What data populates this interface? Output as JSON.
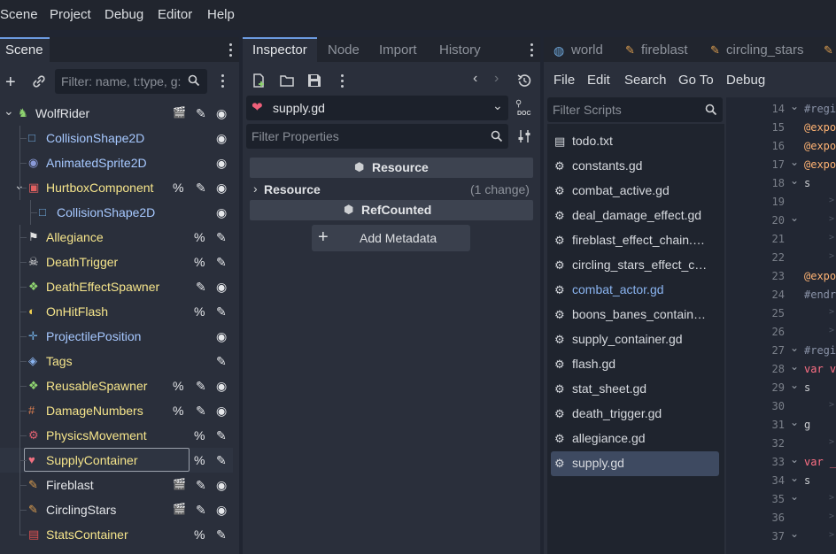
{
  "menubar": {
    "items": [
      "Scene",
      "Project",
      "Debug",
      "Editor",
      "Help"
    ]
  },
  "scene_dock": {
    "tab": "Scene",
    "filter_placeholder": "Filter: name, t:type, g:",
    "nodes": [
      {
        "label": "WolfRider",
        "icon": "kinematic-body-icon",
        "color": "#e4e6e9",
        "flags": [
          "clapper",
          "script",
          "eye"
        ]
      },
      {
        "label": "CollisionShape2D",
        "icon": "collision-shape-icon",
        "color": "#a6c8ff",
        "flags": [
          "eye"
        ]
      },
      {
        "label": "AnimatedSprite2D",
        "icon": "animated-sprite-icon",
        "color": "#a6c8ff",
        "flags": [
          "eye"
        ]
      },
      {
        "label": "HurtboxComponent",
        "icon": "hurtbox-icon",
        "color": "#f6e58b",
        "flags": [
          "%",
          "script",
          "eye"
        ]
      },
      {
        "label": "CollisionShape2D",
        "icon": "collision-shape-icon",
        "color": "#a6c8ff",
        "flags": [
          "eye"
        ]
      },
      {
        "label": "Allegiance",
        "icon": "allegiance-icon",
        "color": "#f6e58b",
        "flags": [
          "%",
          "script"
        ]
      },
      {
        "label": "DeathTrigger",
        "icon": "skull-icon",
        "color": "#f6e58b",
        "flags": [
          "%",
          "script"
        ]
      },
      {
        "label": "DeathEffectSpawner",
        "icon": "spawner-icon",
        "color": "#f6e58b",
        "flags": [
          "script",
          "eye"
        ]
      },
      {
        "label": "OnHitFlash",
        "icon": "bulb-icon",
        "color": "#f6e58b",
        "flags": [
          "%",
          "script"
        ]
      },
      {
        "label": "ProjectilePosition",
        "icon": "marker-icon",
        "color": "#a6c8ff",
        "flags": [
          "eye"
        ]
      },
      {
        "label": "Tags",
        "icon": "tag-icon",
        "color": "#f6e58b",
        "flags": [
          "script"
        ]
      },
      {
        "label": "ReusableSpawner",
        "icon": "spawner-icon",
        "color": "#f6e58b",
        "flags": [
          "%",
          "script",
          "eye"
        ]
      },
      {
        "label": "DamageNumbers",
        "icon": "damage-numbers-icon",
        "color": "#f6e58b",
        "flags": [
          "%",
          "script",
          "eye"
        ]
      },
      {
        "label": "PhysicsMovement",
        "icon": "physics-icon",
        "color": "#f6e58b",
        "flags": [
          "%",
          "script"
        ]
      },
      {
        "label": "SupplyContainer",
        "icon": "heart-box-icon",
        "color": "#f6e58b",
        "flags": [
          "%",
          "script"
        ]
      },
      {
        "label": "Fireblast",
        "icon": "scroll-icon",
        "color": "#e4e6e9",
        "flags": [
          "clapper",
          "script",
          "eye"
        ]
      },
      {
        "label": "CirclingStars",
        "icon": "scroll-icon",
        "color": "#e4e6e9",
        "flags": [
          "clapper",
          "script",
          "eye"
        ]
      },
      {
        "label": "StatsContainer",
        "icon": "stats-icon",
        "color": "#f6e58b",
        "flags": [
          "%",
          "script"
        ]
      }
    ]
  },
  "inspector": {
    "tabs": [
      "Inspector",
      "Node",
      "Import",
      "History"
    ],
    "resource_name": "supply.gd",
    "filter_placeholder": "Filter Properties",
    "section_resource": "Resource",
    "group_resource": "Resource",
    "change_note": "(1 change)",
    "section_refcounted": "RefCounted",
    "add_metadata": "Add Metadata"
  },
  "script_editor": {
    "tabs": [
      "world",
      "fireblast",
      "circling_stars"
    ],
    "menu": [
      "File",
      "Edit",
      "Search",
      "Go To",
      "Debug"
    ],
    "filter_placeholder": "Filter Scripts",
    "scripts": [
      "todo.txt",
      "constants.gd",
      "combat_active.gd",
      "deal_damage_effect.gd",
      "fireblast_effect_chain.…",
      "circling_stars_effect_c…",
      "combat_actor.gd",
      "boons_banes_contain…",
      "supply_container.gd",
      "flash.gd",
      "stat_sheet.gd",
      "death_trigger.gd",
      "allegiance.gd",
      "supply.gd"
    ],
    "selected_index": 13,
    "highlight_index": 6,
    "line_numbers": [
      "14",
      "15",
      "16",
      "17",
      "18",
      "19",
      "20",
      "21",
      "22",
      "23",
      "24",
      "25",
      "26",
      "27",
      "28",
      "29",
      "30",
      "31",
      "32",
      "33",
      "34",
      "35",
      "36",
      "37"
    ],
    "code": [
      "#regi",
      "@expo",
      "@expo",
      "@expo",
      "s",
      "",
      "",
      "",
      "",
      "@expo",
      "#endr",
      "",
      "",
      "#regi",
      "var v",
      "s",
      "",
      "g",
      "",
      "var _",
      "s",
      "",
      "",
      ""
    ],
    "folds": [
      true,
      false,
      false,
      true,
      true,
      false,
      true,
      false,
      false,
      false,
      false,
      false,
      false,
      true,
      true,
      true,
      false,
      true,
      false,
      true,
      true,
      true,
      false,
      true
    ]
  },
  "colors": {
    "accent": "#6b9ae0",
    "selected": "#3e4a61"
  }
}
